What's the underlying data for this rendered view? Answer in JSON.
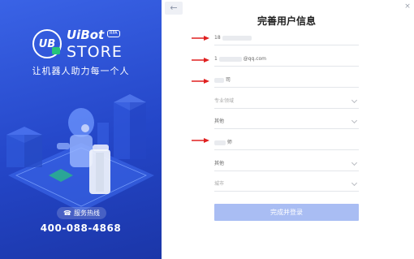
{
  "brand": {
    "badge": "UB",
    "name_top": "UiBot",
    "rpa_tag": "RPA",
    "name_bottom": "STORE",
    "slogan": "让机器人助力每一个人"
  },
  "support": {
    "hotline_label": "服务热线",
    "phone": "400-088-4868"
  },
  "nav": {
    "back_symbol": "←",
    "close_symbol": "×"
  },
  "form": {
    "title": "完善用户信息",
    "fields": [
      {
        "value": "18",
        "kind": "text"
      },
      {
        "value_prefix": "1",
        "value_suffix": "@qq.com",
        "kind": "text"
      },
      {
        "value": "司",
        "kind": "text"
      },
      {
        "placeholder": "专业领域",
        "kind": "select"
      },
      {
        "value": "其他",
        "kind": "select"
      },
      {
        "value": "师",
        "kind": "text"
      },
      {
        "value": "其他",
        "kind": "select"
      },
      {
        "placeholder": "城市",
        "kind": "select"
      }
    ],
    "submit_label": "完成并登录"
  },
  "colors": {
    "panel_blue": "#2b50d6",
    "annotation_red": "#e02020",
    "submit_disabled": "#a9bdf3"
  }
}
